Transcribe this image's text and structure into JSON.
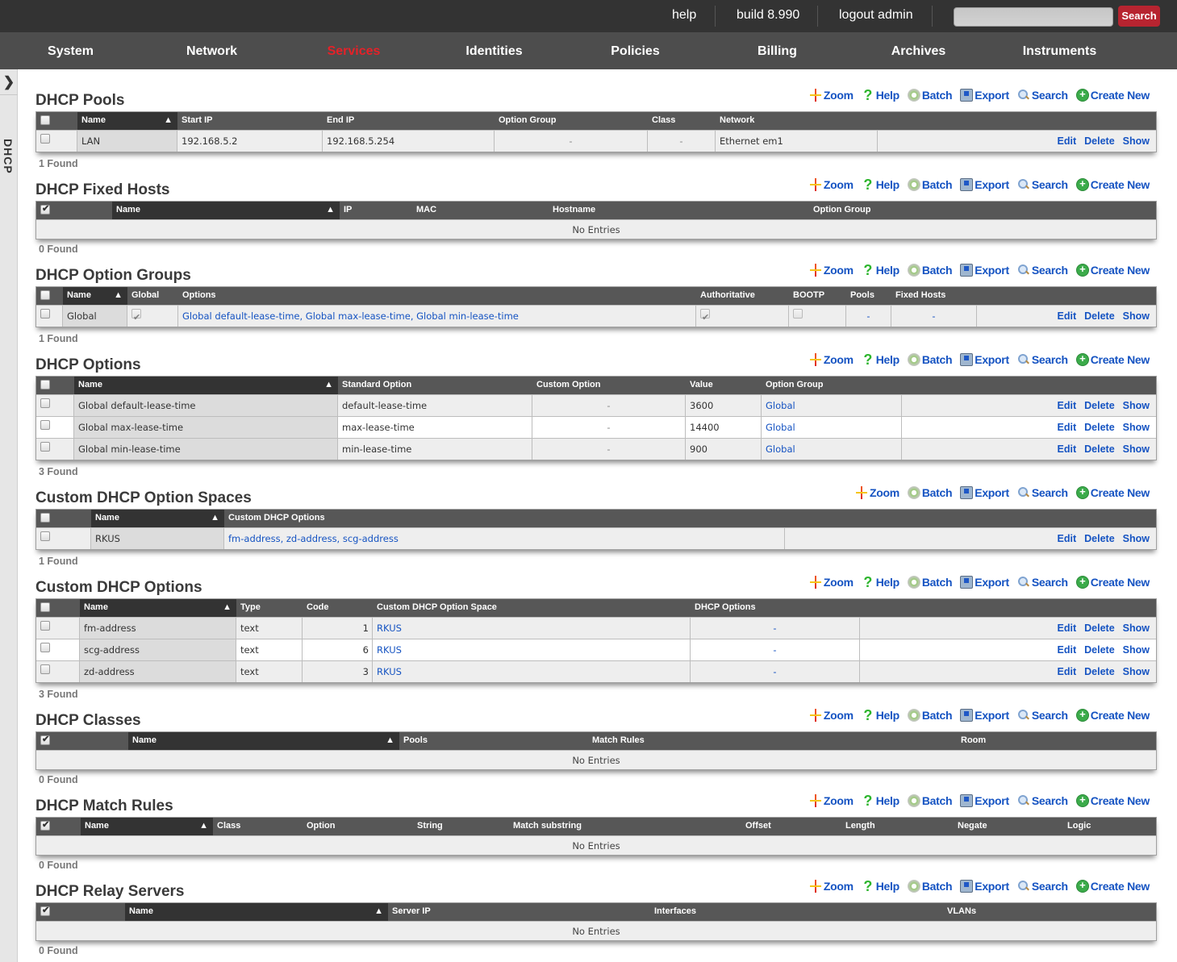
{
  "topbar": {
    "help": "help",
    "build": "build 8.990",
    "logout": "logout admin",
    "search_placeholder": "",
    "search_button": "Search"
  },
  "nav": {
    "items": [
      "System",
      "Network",
      "Services",
      "Identities",
      "Policies",
      "Billing",
      "Archives",
      "Instruments"
    ],
    "active": "Services",
    "active_color": "#e52128"
  },
  "sidebar": {
    "toggle_icon": "chevron-right-icon",
    "label": "DHCP"
  },
  "toolbar": {
    "zoom": "Zoom",
    "help": "Help",
    "batch": "Batch",
    "export": "Export",
    "search": "Search",
    "create": "Create New"
  },
  "row_actions": {
    "edit": "Edit",
    "delete": "Delete",
    "show": "Show"
  },
  "no_entries": "No Entries",
  "sections": {
    "pools": {
      "title": "DHCP Pools",
      "headers": [
        "Name",
        "Start IP",
        "End IP",
        "Option Group",
        "Class",
        "Network"
      ],
      "rows": [
        [
          "LAN",
          "192.168.5.2",
          "192.168.5.254",
          "-",
          "-",
          "Ethernet em1"
        ]
      ],
      "found": "1 Found"
    },
    "fixed_hosts": {
      "title": "DHCP Fixed Hosts",
      "headers": [
        "Name",
        "IP",
        "MAC",
        "Hostname",
        "Option Group"
      ],
      "found": "0 Found"
    },
    "option_groups": {
      "title": "DHCP Option Groups",
      "headers": [
        "Name",
        "Global",
        "Options",
        "Authoritative",
        "BOOTP",
        "Pools",
        "Fixed Hosts"
      ],
      "rows": [
        {
          "name": "Global",
          "global": true,
          "options": "Global default-lease-time, Global max-lease-time, Global min-lease-time",
          "authoritative": true,
          "bootp": false,
          "pools": "-",
          "fixed_hosts": "-"
        }
      ],
      "found": "1 Found"
    },
    "options": {
      "title": "DHCP Options",
      "headers": [
        "Name",
        "Standard Option",
        "Custom Option",
        "Value",
        "Option Group"
      ],
      "rows": [
        [
          "Global default-lease-time",
          "default-lease-time",
          "-",
          "3600",
          "Global"
        ],
        [
          "Global max-lease-time",
          "max-lease-time",
          "-",
          "14400",
          "Global"
        ],
        [
          "Global min-lease-time",
          "min-lease-time",
          "-",
          "900",
          "Global"
        ]
      ],
      "found": "3 Found"
    },
    "option_spaces": {
      "title": "Custom DHCP Option Spaces",
      "headers": [
        "Name",
        "Custom DHCP Options"
      ],
      "rows": [
        [
          "RKUS",
          "fm-address, zd-address, scg-address"
        ]
      ],
      "found": "1 Found"
    },
    "custom_options": {
      "title": "Custom DHCP Options",
      "headers": [
        "Name",
        "Type",
        "Code",
        "Custom DHCP Option Space",
        "DHCP Options"
      ],
      "rows": [
        [
          "fm-address",
          "text",
          "1",
          "RKUS",
          "-"
        ],
        [
          "scg-address",
          "text",
          "6",
          "RKUS",
          "-"
        ],
        [
          "zd-address",
          "text",
          "3",
          "RKUS",
          "-"
        ]
      ],
      "found": "3 Found"
    },
    "classes": {
      "title": "DHCP Classes",
      "headers": [
        "Name",
        "Pools",
        "Match Rules",
        "Room"
      ],
      "found": "0 Found"
    },
    "match_rules": {
      "title": "DHCP Match Rules",
      "headers": [
        "Name",
        "Class",
        "Option",
        "String",
        "Match substring",
        "Offset",
        "Length",
        "Negate",
        "Logic"
      ],
      "found": "0 Found"
    },
    "relay_servers": {
      "title": "DHCP Relay Servers",
      "headers": [
        "Name",
        "Server IP",
        "Interfaces",
        "VLANs"
      ],
      "found": "0 Found"
    }
  }
}
